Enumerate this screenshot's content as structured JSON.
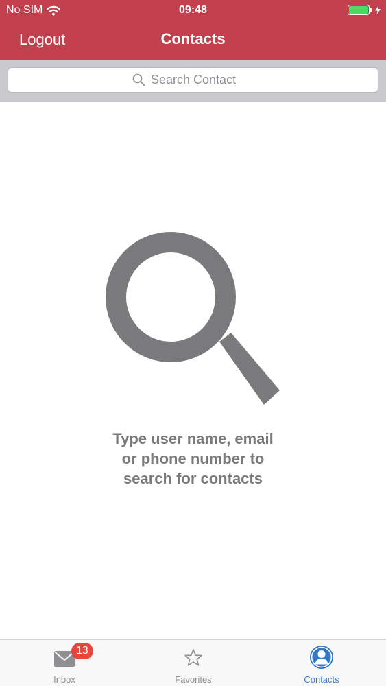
{
  "status_bar": {
    "carrier": "No SIM",
    "time": "09:48",
    "wifi_icon": "wifi-icon",
    "battery_icon": "battery-icon",
    "charging_icon": "bolt-icon"
  },
  "nav": {
    "left_button": "Logout",
    "title": "Contacts"
  },
  "search": {
    "icon": "search-icon",
    "placeholder": "Search Contact",
    "value": ""
  },
  "empty_state": {
    "icon": "search-icon",
    "line1": "Type user name, email",
    "line2": "or phone number to",
    "line3": "search for contacts"
  },
  "tabs": [
    {
      "label": "Inbox",
      "icon": "mail-icon",
      "badge": "13"
    },
    {
      "label": "Favorites",
      "icon": "star-icon"
    },
    {
      "label": "Contacts",
      "icon": "person-icon",
      "selected": true
    }
  ],
  "colors": {
    "header_background": "#c23f4e",
    "search_bar_background": "#c9c9ce",
    "hint_text": "#7a7a7c",
    "icon_gray": "#7a7a7c",
    "tab_active": "#3478c8",
    "tab_inactive": "#8e8e93",
    "badge": "#e5463d",
    "battery": "#4cd964"
  }
}
